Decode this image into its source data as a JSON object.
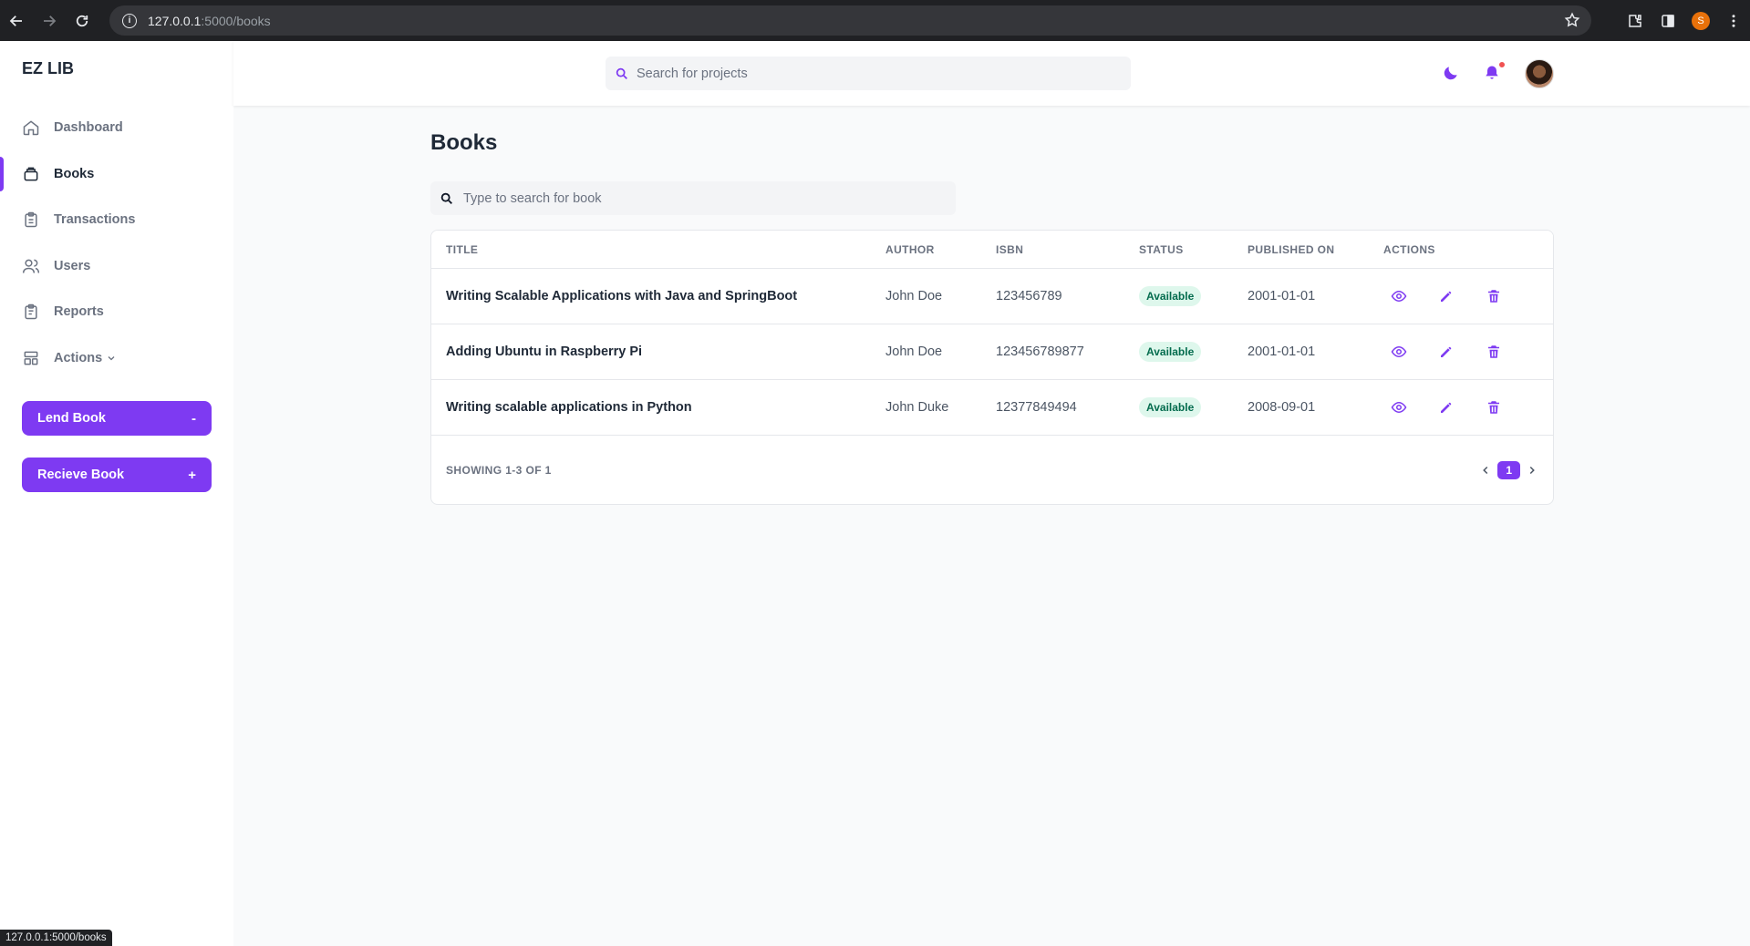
{
  "browser": {
    "url_host": "127.0.0.1",
    "url_path": ":5000/books",
    "profile_initial": "S",
    "status_url": "127.0.0.1:5000/books"
  },
  "app": {
    "brand": "EZ LIB"
  },
  "sidebar": {
    "items": [
      {
        "label": "Dashboard",
        "icon": "home-icon"
      },
      {
        "label": "Books",
        "icon": "book-icon",
        "active": true
      },
      {
        "label": "Transactions",
        "icon": "clipboard-icon"
      },
      {
        "label": "Users",
        "icon": "users-icon"
      },
      {
        "label": "Reports",
        "icon": "report-icon"
      },
      {
        "label": "Actions",
        "icon": "template-icon"
      }
    ],
    "lend_label": "Lend Book",
    "lend_symbol": "-",
    "receive_label": "Recieve Book",
    "receive_symbol": "+"
  },
  "header": {
    "search_placeholder": "Search for projects"
  },
  "main": {
    "title": "Books",
    "search_placeholder": "Type to search for book",
    "columns": [
      "Title",
      "Author",
      "ISBN",
      "Status",
      "Published On",
      "Actions"
    ],
    "rows": [
      {
        "title": "Writing Scalable Applications with Java and SpringBoot",
        "author": "John Doe",
        "isbn": "123456789",
        "status": "Available",
        "published": "2001-01-01"
      },
      {
        "title": "Adding Ubuntu in Raspberry Pi",
        "author": "John Doe",
        "isbn": "123456789877",
        "status": "Available",
        "published": "2001-01-01"
      },
      {
        "title": "Writing scalable applications in Python",
        "author": "John Duke",
        "isbn": "12377849494",
        "status": "Available",
        "published": "2008-09-01"
      }
    ],
    "showing": "Showing 1-3 of 1",
    "current_page": "1"
  },
  "colors": {
    "accent": "#7e3af2",
    "badge_bg": "#def7ec",
    "badge_text": "#046c4e",
    "notification": "#f05252"
  }
}
